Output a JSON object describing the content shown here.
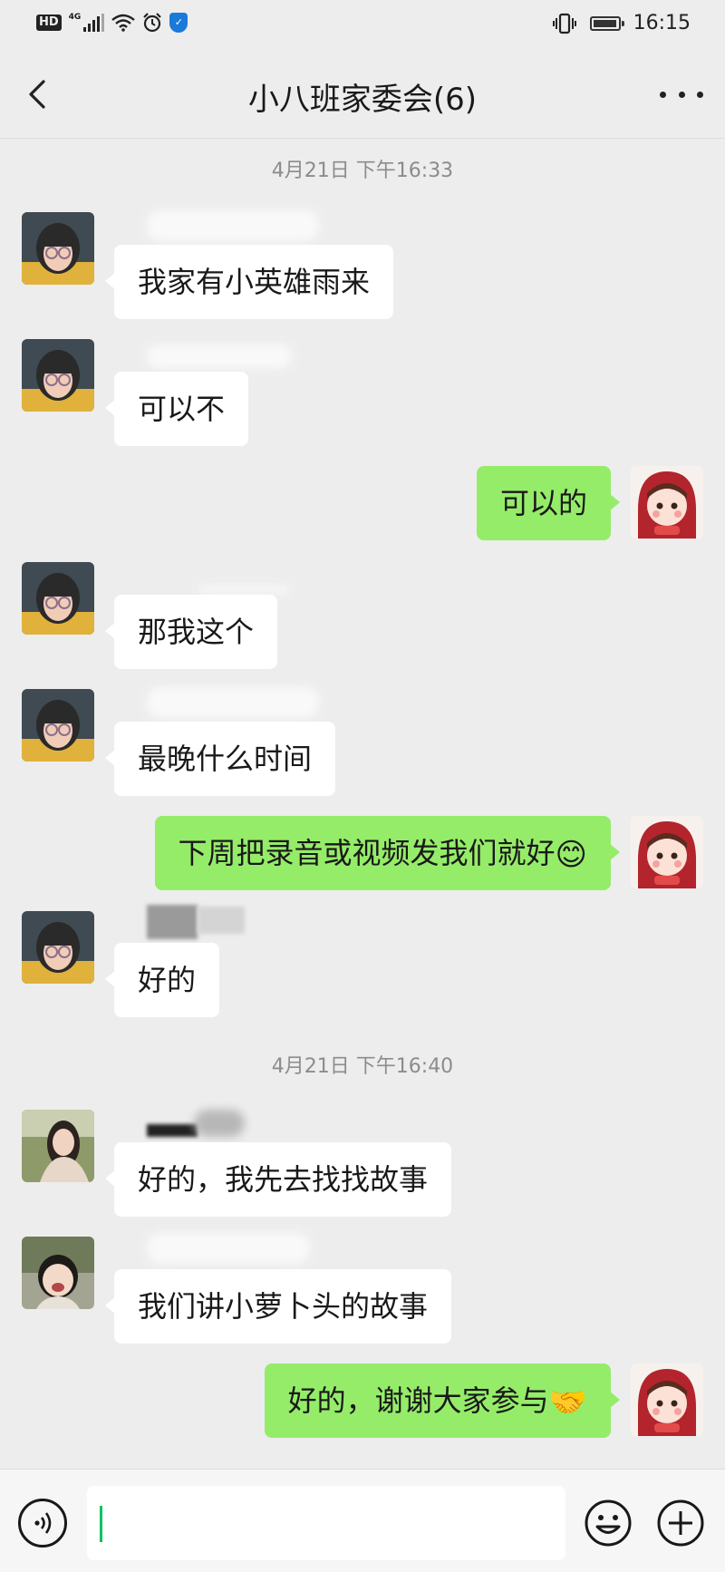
{
  "status_bar": {
    "hd": "HD",
    "network": "4G",
    "shield": "✓",
    "time": "16:15"
  },
  "header": {
    "title": "小八班家委会(6)"
  },
  "timestamps": [
    "4月21日 下午16:33",
    "4月21日 下午16:40"
  ],
  "messages": [
    {
      "side": "in",
      "text": "我家有小英雄雨来",
      "avatar": "avatar-girl-glasses"
    },
    {
      "side": "in",
      "text": "可以不",
      "avatar": "avatar-girl-glasses"
    },
    {
      "side": "out",
      "text": "可以的",
      "avatar": "avatar-doll-red-hood"
    },
    {
      "side": "in",
      "text": "那我这个",
      "avatar": "avatar-girl-glasses"
    },
    {
      "side": "in",
      "text": "最晚什么时间",
      "avatar": "avatar-girl-glasses"
    },
    {
      "side": "out",
      "text": "下周把录音或视频发我们就好",
      "emoji": "😊",
      "avatar": "avatar-doll-red-hood"
    },
    {
      "side": "in",
      "text": "好的",
      "avatar": "avatar-girl-glasses"
    },
    {
      "side": "in",
      "text": "好的，我先去找找故事",
      "avatar": "avatar-woman-scarf"
    },
    {
      "side": "in",
      "text": "我们讲小萝卜头的故事",
      "avatar": "avatar-child-laughing"
    },
    {
      "side": "out",
      "text": "好的，谢谢大家参与",
      "emoji": "🤝",
      "avatar": "avatar-doll-red-hood"
    }
  ],
  "input_bar": {
    "value": ""
  },
  "colors": {
    "background": "#ededed",
    "outgoing_bubble": "#95ec69",
    "incoming_bubble": "#ffffff",
    "caret": "#07c160"
  }
}
